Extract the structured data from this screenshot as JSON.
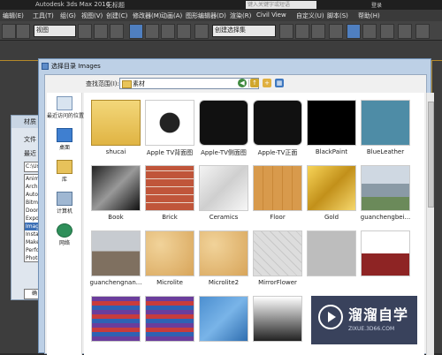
{
  "app": {
    "title": "Autodesk 3ds Max 2016",
    "subtitle": "无标题",
    "search_placeholder": "键入关键字或短语",
    "login_label": "登录"
  },
  "menubar": [
    "编辑(E)",
    "工具(T)",
    "组(G)",
    "视图(V)",
    "创建(C)",
    "修改器(M)",
    "动画(A)",
    "图形编辑器(D)",
    "渲染(R)",
    "Civil View",
    "自定义(U)",
    "脚本(S)",
    "帮助(H)"
  ],
  "toolbar": {
    "view_select": "视图",
    "selection_set": "创建选择集"
  },
  "bg_dialog": {
    "title": "材质",
    "label_file": "文件",
    "label_recent": "最近",
    "path": "C:\\Us",
    "list": [
      "Anim",
      "Arch",
      "Auto",
      "Bitma",
      "Doon",
      "Expo",
      "Imag",
      "Insta",
      "Make",
      "Perfo",
      "Photo",
      "Proxi"
    ],
    "button": "确"
  },
  "dialog": {
    "title": "选择目录 Images",
    "look_in_label": "查找范围(I):",
    "look_in_value": "素材",
    "places": [
      {
        "label": "最近访问的位置",
        "icon": "recent-places-icon"
      },
      {
        "label": "桌面",
        "icon": "desktop-icon"
      },
      {
        "label": "库",
        "icon": "libraries-icon"
      },
      {
        "label": "计算机",
        "icon": "computer-icon"
      },
      {
        "label": "网络",
        "icon": "network-icon"
      }
    ],
    "files": [
      {
        "name": "shucai",
        "kind": "folder"
      },
      {
        "name": "Apple TV背面图",
        "kind": "appletv-top"
      },
      {
        "name": "Apple-TV侧面图",
        "kind": "appletv"
      },
      {
        "name": "Apple-TV正面",
        "kind": "appletv"
      },
      {
        "name": "BlackPaint",
        "kind": "black"
      },
      {
        "name": "BlueLeather",
        "kind": "blueleather"
      },
      {
        "name": "Book",
        "kind": "book"
      },
      {
        "name": "Brick",
        "kind": "brick"
      },
      {
        "name": "Ceramics",
        "kind": "ceramics"
      },
      {
        "name": "Floor",
        "kind": "floor"
      },
      {
        "name": "Gold",
        "kind": "gold"
      },
      {
        "name": "guanchengbei...",
        "kind": "photo"
      },
      {
        "name": "guanchengnan...",
        "kind": "photo2"
      },
      {
        "name": "Microlite",
        "kind": "microlite"
      },
      {
        "name": "Microlite2",
        "kind": "microlite"
      },
      {
        "name": "MirrorFlower",
        "kind": "mirrorflower"
      },
      {
        "name": "",
        "kind": "grey"
      },
      {
        "name": "",
        "kind": "redwood"
      },
      {
        "name": "",
        "kind": "winrar"
      },
      {
        "name": "",
        "kind": "winrar"
      },
      {
        "name": "",
        "kind": "bluetile"
      },
      {
        "name": "",
        "kind": "gradient"
      }
    ]
  },
  "watermark": {
    "brand": "溜溜自学",
    "url": "ZIXUE.3D66.COM"
  }
}
